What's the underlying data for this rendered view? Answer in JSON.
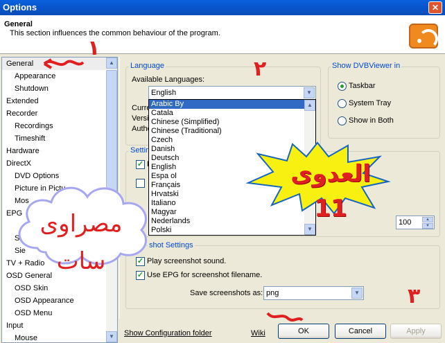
{
  "window": {
    "title": "Options",
    "close_glyph": "✕"
  },
  "header": {
    "title": "General",
    "description": "This section influences the common behaviour of the program.",
    "icon": "rss-feed-icon"
  },
  "tree": {
    "items": [
      {
        "label": "General",
        "level": 0,
        "selected": true
      },
      {
        "label": "Appearance",
        "level": 1
      },
      {
        "label": "Shutdown",
        "level": 1
      },
      {
        "label": "Extended",
        "level": 0
      },
      {
        "label": "Recorder",
        "level": 0
      },
      {
        "label": "Recordings",
        "level": 1
      },
      {
        "label": "Timeshift",
        "level": 1
      },
      {
        "label": "Hardware",
        "level": 0
      },
      {
        "label": "DirectX",
        "level": 0
      },
      {
        "label": "DVD Options",
        "level": 1
      },
      {
        "label": "Picture in Pictu",
        "level": 1
      },
      {
        "label": "Mos",
        "level": 1
      },
      {
        "label": "EPG",
        "level": 0
      },
      {
        "label": "",
        "level": 1
      },
      {
        "label": "So",
        "level": 1
      },
      {
        "label": "Sie",
        "level": 1
      },
      {
        "label": "TV + Radio",
        "level": 0
      },
      {
        "label": "OSD General",
        "level": 0
      },
      {
        "label": "OSD Skin",
        "level": 1
      },
      {
        "label": "OSD Appearance",
        "level": 1
      },
      {
        "label": "OSD Menu",
        "level": 1
      },
      {
        "label": "Input",
        "level": 0
      },
      {
        "label": "Mouse",
        "level": 1
      }
    ]
  },
  "language": {
    "group_title": "Language",
    "available_label": "Available Languages:",
    "selected": "English",
    "hidden_labels": [
      "Curre",
      "Versi",
      "Autho"
    ],
    "options": [
      "Arabic By",
      "Catala",
      "Chinese (Simplified)",
      "Chinese (Traditional)",
      "Czech",
      "Danish",
      "Deutsch",
      "English",
      "Espa ol",
      "Français",
      "Hrvatski",
      "Italiano",
      "Magyar",
      "Nederlands",
      "Polski"
    ],
    "highlighted_index": 0
  },
  "show_in": {
    "group_title": "Show DVBViewer in",
    "options": [
      {
        "label": "Taskbar",
        "checked": true
      },
      {
        "label": "System Tray",
        "checked": false
      },
      {
        "label": "Show in Both",
        "checked": false
      }
    ]
  },
  "settings": {
    "group_title_partial": "Settin",
    "checkbox_label_partial": "P",
    "spin_value": "100"
  },
  "screenshot": {
    "group_title_partial": "shot Settings",
    "play_sound": "Play screenshot sound.",
    "use_epg": "Use EPG for screenshot filename.",
    "save_as_label": "Save screenshots as:",
    "save_as_value": "png"
  },
  "footer": {
    "show_config": "Show Configuration folder",
    "wiki": "Wiki",
    "ok": "OK",
    "cancel": "Cancel",
    "apply": "Apply"
  },
  "overlays": {
    "burst_text": "العدوى 11",
    "cloud_text": "مصراوى سات",
    "mark_1": "١",
    "mark_2": "٢",
    "mark_3": "٣",
    "accent_color": "#E02020"
  }
}
